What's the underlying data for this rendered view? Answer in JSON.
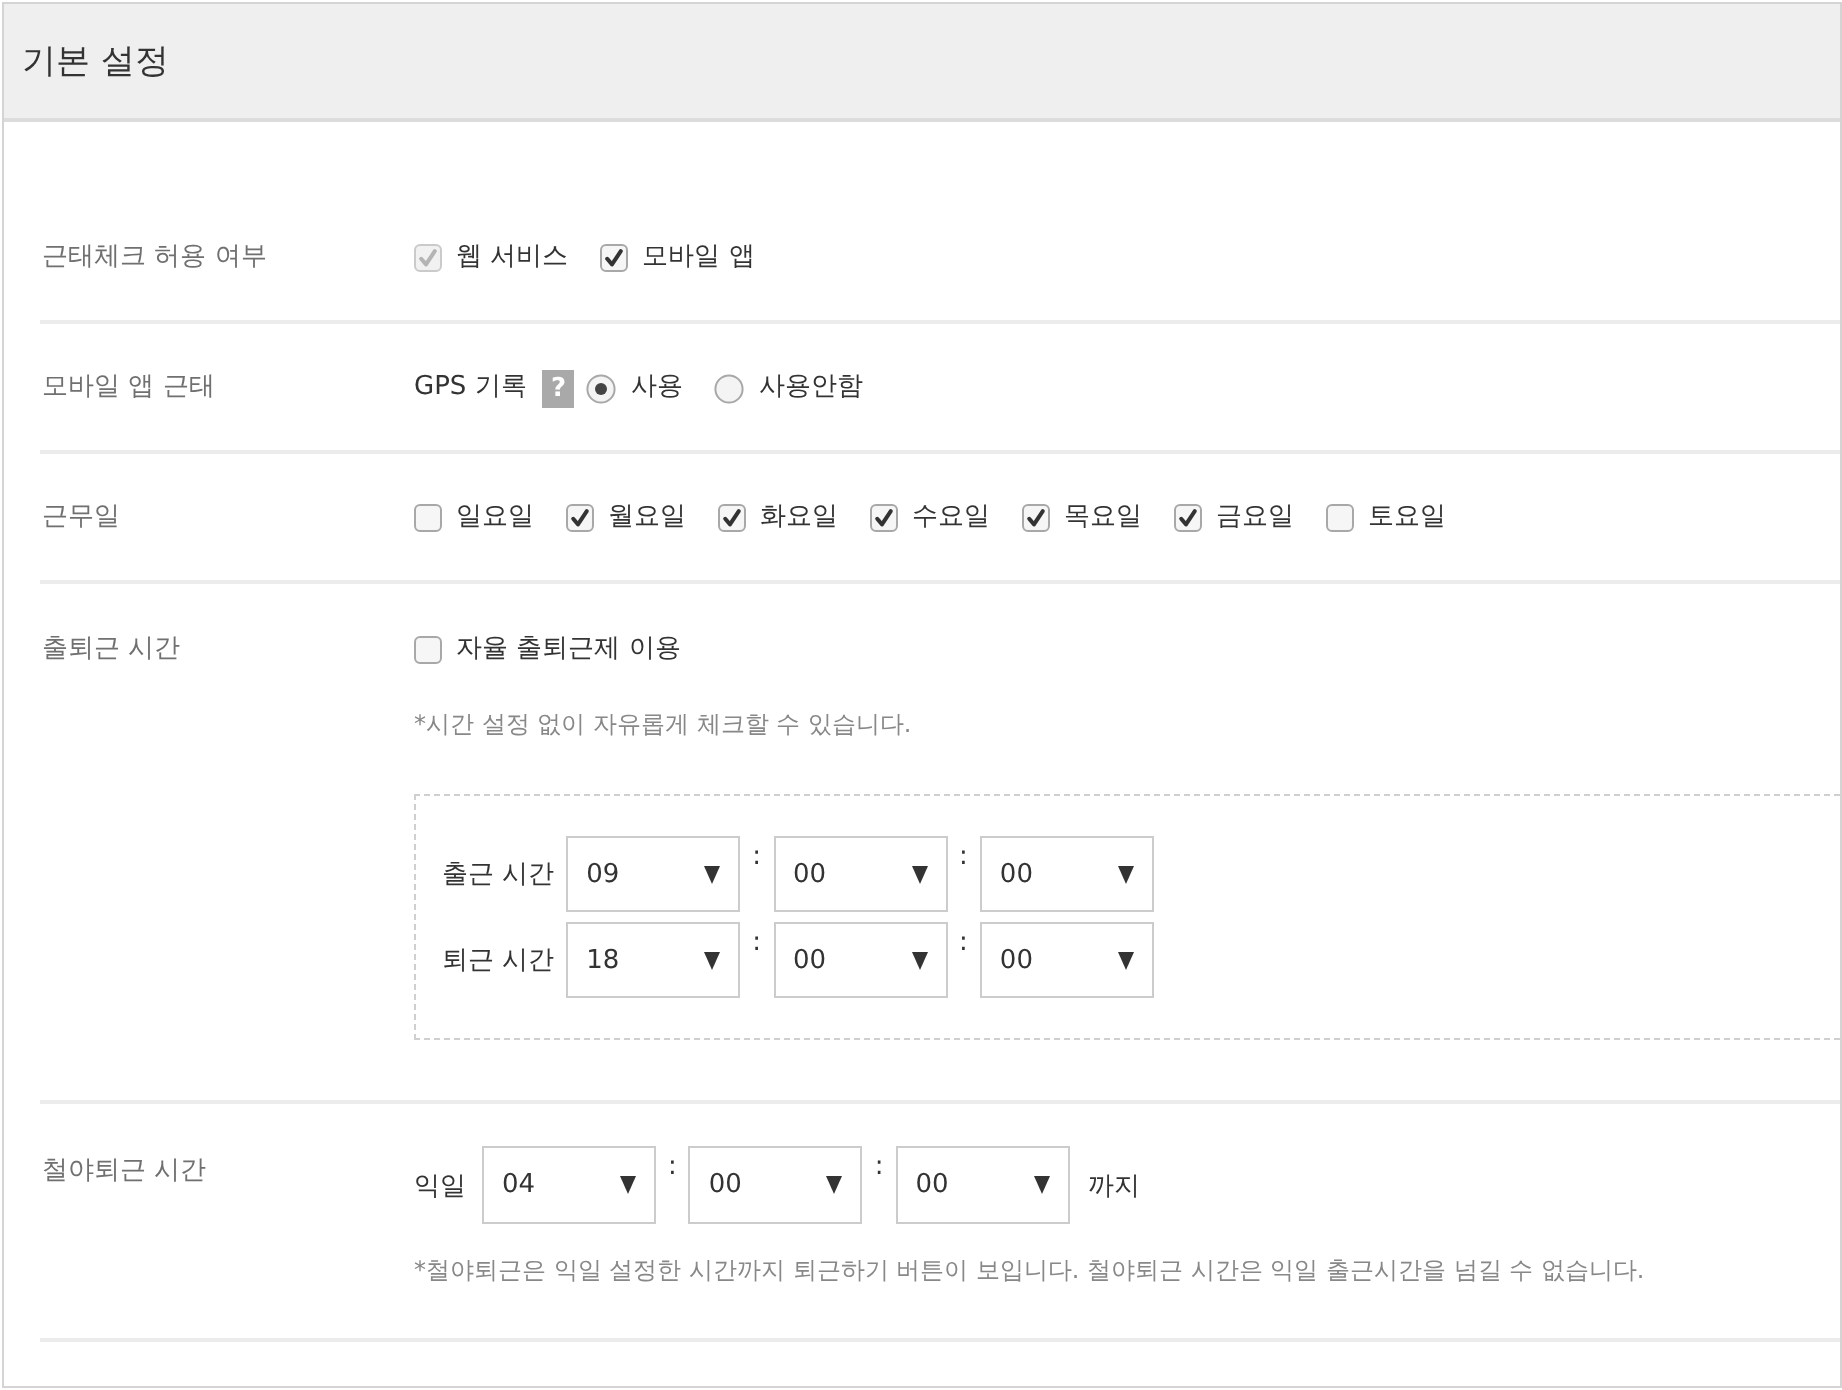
{
  "header": {
    "title": "기본 설정"
  },
  "rows": [
    {
      "kind": "checks",
      "label": "근태체크 허용 여부",
      "options": [
        {
          "label": "웹 서비스",
          "checked": true,
          "disabled": true
        },
        {
          "label": "모바일 앱",
          "checked": true,
          "disabled": false
        }
      ]
    },
    {
      "kind": "radios",
      "label": "모바일 앱 근태",
      "prefix": "GPS 기록",
      "help": "?",
      "options": [
        {
          "label": "사용",
          "selected": true
        },
        {
          "label": "사용안함",
          "selected": false
        }
      ]
    },
    {
      "kind": "checks",
      "label": "근무일",
      "options": [
        {
          "label": "일요일",
          "checked": false
        },
        {
          "label": "월요일",
          "checked": true
        },
        {
          "label": "화요일",
          "checked": true
        },
        {
          "label": "수요일",
          "checked": true
        },
        {
          "label": "목요일",
          "checked": true
        },
        {
          "label": "금요일",
          "checked": true
        },
        {
          "label": "토요일",
          "checked": false
        }
      ]
    },
    {
      "kind": "schedule",
      "label": "출퇴근 시간",
      "option": {
        "label": "자율 출퇴근제 이용",
        "checked": false
      },
      "note": "*시간 설정 없이 자유롭게 체크할 수 있습니다.",
      "times": [
        {
          "label": "출근 시간",
          "fields": [
            {
              "value": "09"
            },
            {
              "separator": ":",
              "value": "00"
            },
            {
              "separator": ":",
              "value": "00"
            }
          ]
        },
        {
          "label": "퇴근 시간",
          "fields": [
            {
              "value": "18"
            },
            {
              "separator": ":",
              "value": "00"
            },
            {
              "separator": ":",
              "value": "00"
            }
          ]
        }
      ]
    },
    {
      "kind": "deadline",
      "label": "철야퇴근 시간",
      "prefix": "익일",
      "fields": [
        {
          "value": "04"
        },
        {
          "separator": ":",
          "value": "00"
        },
        {
          "separator": ":",
          "value": "00"
        }
      ],
      "suffix": "까지",
      "note": "*철야퇴근은 익일 설정한 시간까지 퇴근하기 버튼이 보입니다. 철야퇴근 시간은 익일 출근시간을 넘길 수 없습니다."
    }
  ]
}
